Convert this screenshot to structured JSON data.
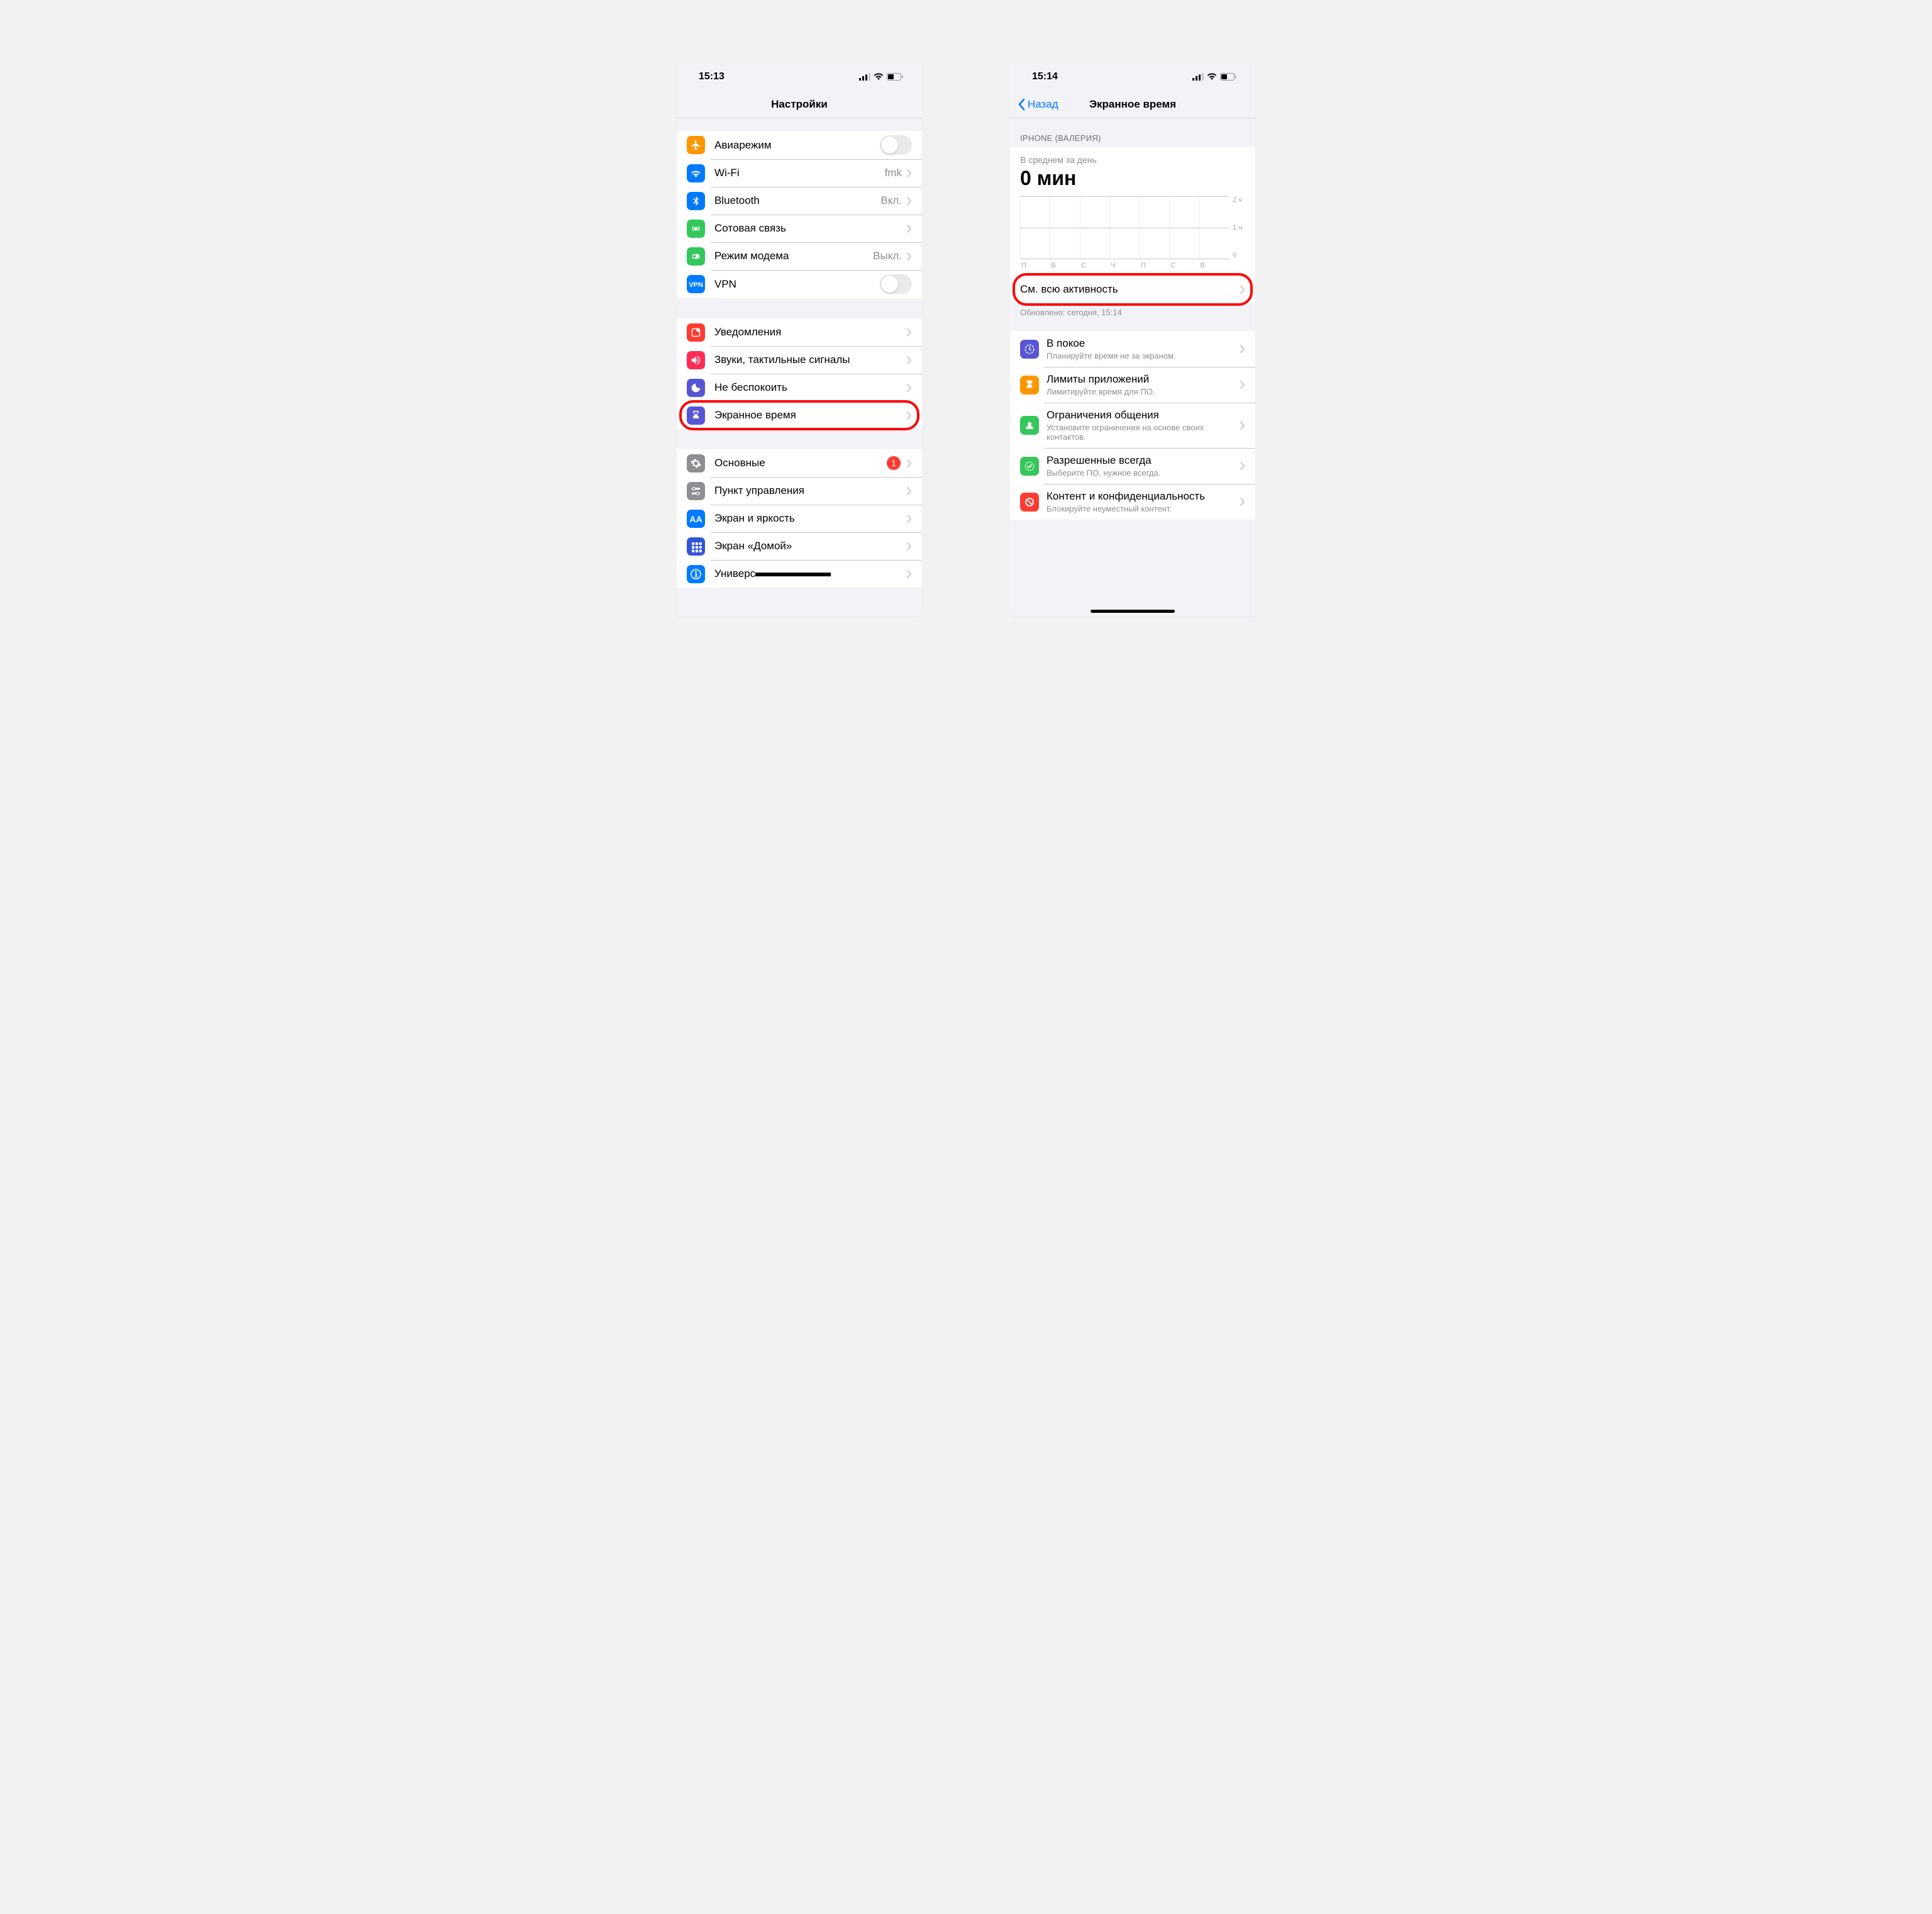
{
  "left": {
    "status_time": "15:13",
    "title": "Настройки",
    "g1": [
      {
        "icon": "airplane",
        "bg": "#ff9500",
        "label": "Авиарежим",
        "type": "switch"
      },
      {
        "icon": "wifi",
        "bg": "#007aff",
        "label": "Wi-Fi",
        "value": "fmk",
        "type": "link"
      },
      {
        "icon": "bluetooth",
        "bg": "#007aff",
        "label": "Bluetooth",
        "value": "Вкл.",
        "type": "link"
      },
      {
        "icon": "cellular",
        "bg": "#34c759",
        "label": "Сотовая связь",
        "type": "link"
      },
      {
        "icon": "hotspot",
        "bg": "#34c759",
        "label": "Режим модема",
        "value": "Выкл.",
        "type": "link"
      },
      {
        "icon": "vpn",
        "bg": "#007aff",
        "label": "VPN",
        "type": "switch"
      }
    ],
    "g2": [
      {
        "icon": "notif",
        "bg": "#ff3b30",
        "label": "Уведомления",
        "type": "link"
      },
      {
        "icon": "sound",
        "bg": "#ff2d55",
        "label": "Звуки, тактильные сигналы",
        "type": "link"
      },
      {
        "icon": "moon",
        "bg": "#5856d6",
        "label": "Не беспокоить",
        "type": "link"
      },
      {
        "icon": "hourglass",
        "bg": "#5856d6",
        "label": "Экранное время",
        "type": "link",
        "highlight": true
      }
    ],
    "g3": [
      {
        "icon": "gear",
        "bg": "#8e8e93",
        "label": "Основные",
        "type": "link",
        "badge": "1"
      },
      {
        "icon": "control",
        "bg": "#8e8e93",
        "label": "Пункт управления",
        "type": "link"
      },
      {
        "icon": "display",
        "bg": "#007aff",
        "label": "Экран и яркость",
        "type": "link"
      },
      {
        "icon": "home",
        "bg": "#3255d6",
        "label": "Экран «Домой»",
        "type": "link"
      },
      {
        "icon": "access",
        "bg": "#007aff",
        "label": "Универсальный доступ",
        "type": "link",
        "strike": true
      }
    ]
  },
  "right": {
    "status_time": "15:14",
    "back": "Назад",
    "title": "Экранное время",
    "device_header": "IPHONE (ВАЛЕРИЯ)",
    "avg_label": "В среднем за день",
    "avg_value": "0 мин",
    "ylabels": [
      "2 ч",
      "1 ч",
      "0"
    ],
    "xlabels": [
      "П",
      "В",
      "С",
      "Ч",
      "П",
      "С",
      "В"
    ],
    "see_all": "См. всю активность",
    "updated": "Обновлено: сегодня, 15:14",
    "options": [
      {
        "icon": "downtime",
        "bg": "#5856d6",
        "title": "В покое",
        "sub": "Планируйте время не за экраном."
      },
      {
        "icon": "limits",
        "bg": "#ff9500",
        "title": "Лимиты приложений",
        "sub": "Лимитируйте время для ПО."
      },
      {
        "icon": "comm",
        "bg": "#34c759",
        "title": "Ограничения общения",
        "sub": "Установите ограничения на основе своих контактов."
      },
      {
        "icon": "allowed",
        "bg": "#34c759",
        "title": "Разрешенные всегда",
        "sub": "Выберите ПО, нужное всегда."
      },
      {
        "icon": "content",
        "bg": "#ff3b30",
        "title": "Контент и конфиденциальность",
        "sub": "Блокируйте неуместный контент."
      }
    ]
  }
}
